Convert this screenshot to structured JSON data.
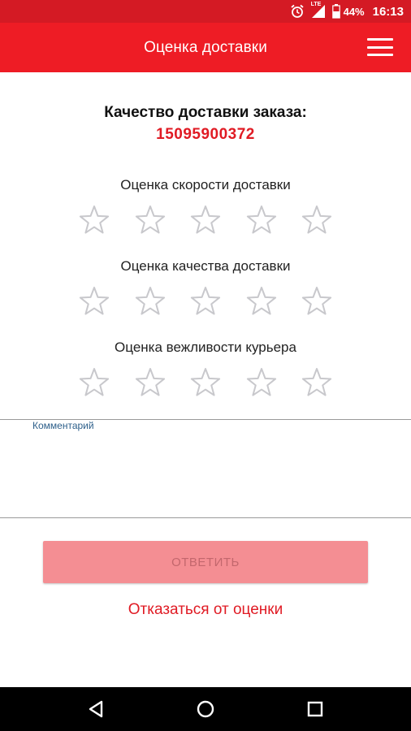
{
  "status_bar": {
    "network": "LTE",
    "battery": "44%",
    "time": "16:13",
    "icons": [
      "alarm-icon",
      "signal-icon",
      "battery-icon"
    ]
  },
  "app_bar": {
    "title": "Оценка доставки",
    "menu_icon": "hamburger-menu-icon"
  },
  "order": {
    "heading": "Качество доставки заказа:",
    "number": "15095900372"
  },
  "ratings": [
    {
      "label": "Оценка скорости доставки",
      "stars_total": 5,
      "stars_selected": 0
    },
    {
      "label": "Оценка качества доставки",
      "stars_total": 5,
      "stars_selected": 0
    },
    {
      "label": "Оценка вежливости курьера",
      "stars_total": 5,
      "stars_selected": 0
    }
  ],
  "comment": {
    "label": "Комментарий",
    "value": ""
  },
  "actions": {
    "submit_label": "ОТВЕТИТЬ",
    "decline_label": "Отказаться от оценки"
  },
  "nav_bar": {
    "icons": [
      "back-icon",
      "home-icon",
      "recents-icon"
    ]
  },
  "colors": {
    "status_bar": "#d41a24",
    "app_bar": "#ee1c25",
    "accent": "#e01b24",
    "submit_disabled": "#f48e93",
    "star_outline": "#c8c8cc",
    "comment_label": "#2d5f8a"
  }
}
